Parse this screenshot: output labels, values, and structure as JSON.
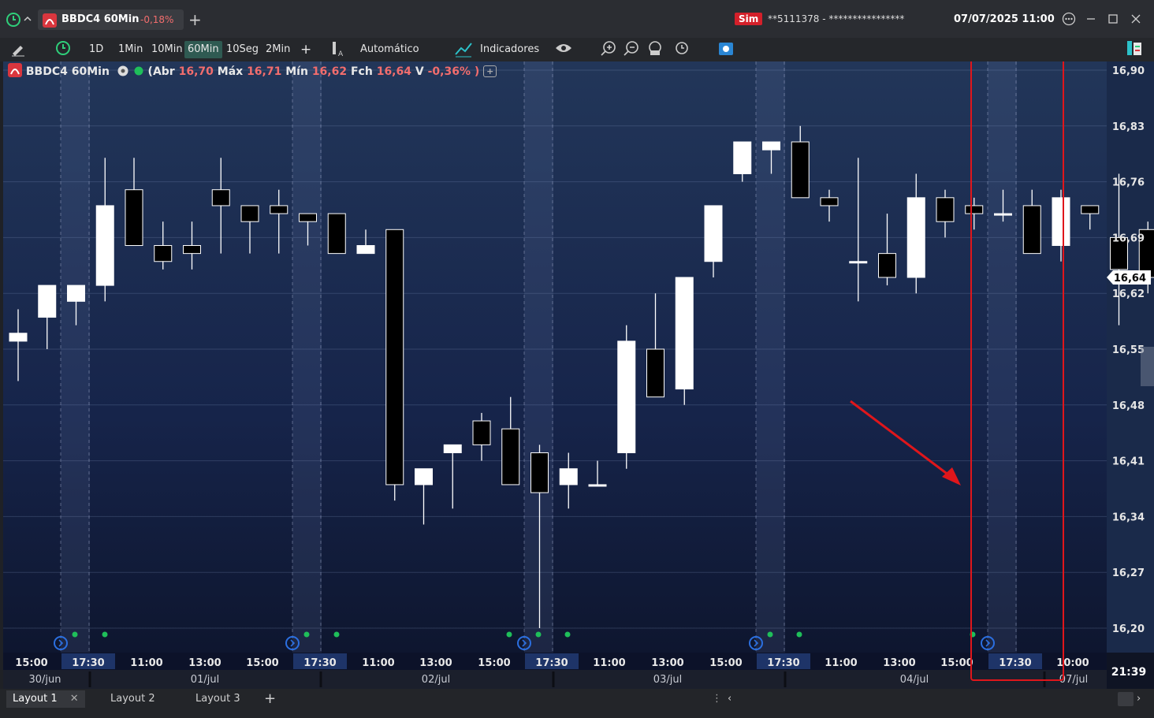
{
  "titlebar": {
    "symbol_tab": "BBDC4 60Min",
    "symbol_change": "-0,18%",
    "add_tab": "+",
    "sim_badge": "Sim",
    "account": "**5111378 - ****************",
    "datetime": "07/07/2025 11:00"
  },
  "toolbar": {
    "intervals": [
      "1D",
      "1Min",
      "10Min",
      "60Min",
      "10Seg",
      "2Min"
    ],
    "selected_interval": "60Min",
    "add": "+",
    "auto_label": "Automático",
    "indicators_label": "Indicadores"
  },
  "info": {
    "symbol": "BBDC4 60Min",
    "abr_label": "(Abr",
    "abr": "16,70",
    "max_label": "Máx",
    "max": "16,71",
    "min_label": "Mín",
    "min": "16,62",
    "fch_label": "Fch",
    "fch": "16,64",
    "v_label": "V",
    "var": "-0,36% )",
    "plus": "+"
  },
  "colors": {
    "up_candle": "#ffffff",
    "down_candle": "#000000",
    "annotation": "#e0161b",
    "current_price_label": "#ffffff",
    "marker_dot": "#1fbf5a",
    "marker_circle": "#2b6fe0"
  },
  "chart_data": {
    "type": "candlestick",
    "title": "BBDC4 60Min",
    "y_ticks": [
      "16,90",
      "16,83",
      "16,76",
      "16,69",
      "16,62",
      "16,55",
      "16,48",
      "16,41",
      "16,34",
      "16,27",
      "16,20"
    ],
    "ylim": [
      16.2,
      16.9
    ],
    "current_price": "16,64",
    "time_ticks": [
      "15:00",
      "17:30",
      "11:00",
      "13:00",
      "15:00",
      "17:30",
      "11:00",
      "13:00",
      "15:00",
      "17:30",
      "11:00",
      "13:00",
      "15:00",
      "17:30",
      "11:00",
      "13:00",
      "15:00",
      "17:30",
      "10:00"
    ],
    "date_ticks": [
      "30/jun",
      "01/jul",
      "02/jul",
      "03/jul",
      "04/jul",
      "07/jul"
    ],
    "clock": "21:39",
    "candles": [
      {
        "o": 16.56,
        "h": 16.6,
        "l": 16.51,
        "c": 16.57
      },
      {
        "o": 16.59,
        "h": 16.62,
        "l": 16.55,
        "c": 16.63
      },
      {
        "o": 16.61,
        "h": 16.63,
        "l": 16.58,
        "c": 16.63
      },
      {
        "o": 16.63,
        "h": 16.79,
        "l": 16.61,
        "c": 16.73
      },
      {
        "o": 16.75,
        "h": 16.79,
        "l": 16.7,
        "c": 16.68
      },
      {
        "o": 16.68,
        "h": 16.71,
        "l": 16.65,
        "c": 16.66
      },
      {
        "o": 16.68,
        "h": 16.71,
        "l": 16.65,
        "c": 16.67
      },
      {
        "o": 16.75,
        "h": 16.79,
        "l": 16.67,
        "c": 16.73
      },
      {
        "o": 16.73,
        "h": 16.73,
        "l": 16.67,
        "c": 16.71
      },
      {
        "o": 16.73,
        "h": 16.75,
        "l": 16.67,
        "c": 16.72
      },
      {
        "o": 16.72,
        "h": 16.72,
        "l": 16.68,
        "c": 16.71
      },
      {
        "o": 16.72,
        "h": 16.72,
        "l": 16.68,
        "c": 16.67
      },
      {
        "o": 16.67,
        "h": 16.7,
        "l": 16.67,
        "c": 16.68
      },
      {
        "o": 16.7,
        "h": 16.7,
        "l": 16.36,
        "c": 16.38
      },
      {
        "o": 16.38,
        "h": 16.39,
        "l": 16.33,
        "c": 16.4
      },
      {
        "o": 16.42,
        "h": 16.4,
        "l": 16.35,
        "c": 16.43
      },
      {
        "o": 16.46,
        "h": 16.47,
        "l": 16.41,
        "c": 16.43
      },
      {
        "o": 16.45,
        "h": 16.49,
        "l": 16.42,
        "c": 16.38
      },
      {
        "o": 16.42,
        "h": 16.43,
        "l": 16.2,
        "c": 16.37
      },
      {
        "o": 16.38,
        "h": 16.42,
        "l": 16.35,
        "c": 16.4
      },
      {
        "o": 16.38,
        "h": 16.41,
        "l": 16.38,
        "c": 16.38
      },
      {
        "o": 16.42,
        "h": 16.58,
        "l": 16.4,
        "c": 16.56
      },
      {
        "o": 16.55,
        "h": 16.62,
        "l": 16.5,
        "c": 16.49
      },
      {
        "o": 16.5,
        "h": 16.64,
        "l": 16.48,
        "c": 16.64
      },
      {
        "o": 16.66,
        "h": 16.73,
        "l": 16.64,
        "c": 16.73
      },
      {
        "o": 16.77,
        "h": 16.81,
        "l": 16.76,
        "c": 16.81
      },
      {
        "o": 16.8,
        "h": 16.81,
        "l": 16.77,
        "c": 16.81
      },
      {
        "o": 16.81,
        "h": 16.83,
        "l": 16.75,
        "c": 16.74
      },
      {
        "o": 16.74,
        "h": 16.75,
        "l": 16.71,
        "c": 16.73
      },
      {
        "o": 16.66,
        "h": 16.79,
        "l": 16.61,
        "c": 16.66
      },
      {
        "o": 16.67,
        "h": 16.72,
        "l": 16.63,
        "c": 16.64
      },
      {
        "o": 16.64,
        "h": 16.77,
        "l": 16.62,
        "c": 16.74
      },
      {
        "o": 16.74,
        "h": 16.75,
        "l": 16.69,
        "c": 16.71
      },
      {
        "o": 16.73,
        "h": 16.74,
        "l": 16.7,
        "c": 16.72
      },
      {
        "o": 16.72,
        "h": 16.75,
        "l": 16.71,
        "c": 16.72
      },
      {
        "o": 16.73,
        "h": 16.75,
        "l": 16.67,
        "c": 16.67
      },
      {
        "o": 16.68,
        "h": 16.75,
        "l": 16.66,
        "c": 16.74
      },
      {
        "o": 16.73,
        "h": 16.73,
        "l": 16.7,
        "c": 16.72
      },
      {
        "o": 16.69,
        "h": 16.77,
        "l": 16.58,
        "c": 16.65
      },
      {
        "o": 16.7,
        "h": 16.71,
        "l": 16.62,
        "c": 16.64
      }
    ]
  },
  "layouts": [
    "Layout 1",
    "Layout 2",
    "Layout 3"
  ],
  "layout_add": "+"
}
